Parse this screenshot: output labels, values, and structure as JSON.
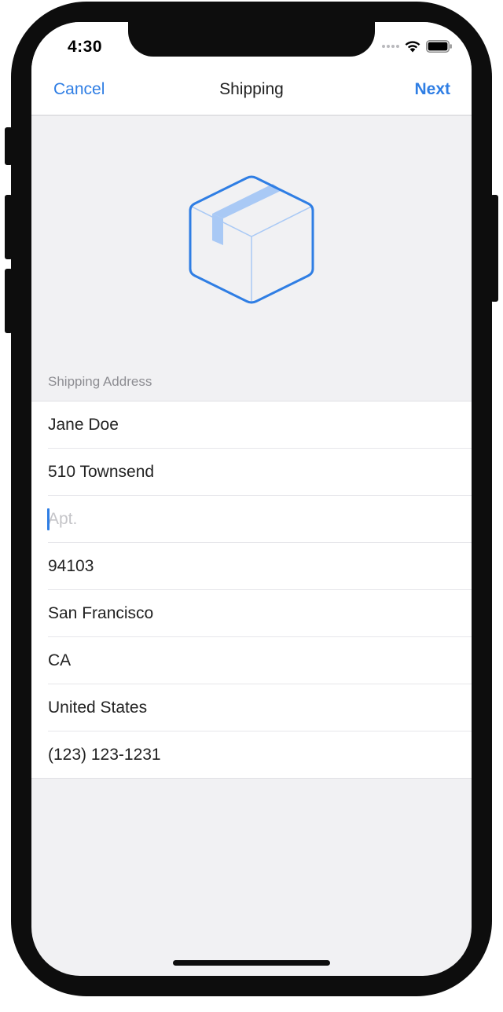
{
  "status_bar": {
    "time": "4:30",
    "icons": [
      "cellular-dots-icon",
      "wifi-icon",
      "battery-icon"
    ]
  },
  "nav": {
    "cancel_label": "Cancel",
    "title": "Shipping",
    "next_label": "Next"
  },
  "illustration": {
    "icon": "package-box-icon",
    "stroke_color": "#2f7ee4",
    "tape_color": "#a9c9f5"
  },
  "section": {
    "header": "Shipping Address"
  },
  "fields": [
    {
      "value": "Jane Doe",
      "placeholder": ""
    },
    {
      "value": "510 Townsend",
      "placeholder": ""
    },
    {
      "value": "",
      "placeholder": "Apt."
    },
    {
      "value": "94103",
      "placeholder": ""
    },
    {
      "value": "San Francisco",
      "placeholder": ""
    },
    {
      "value": "CA",
      "placeholder": ""
    },
    {
      "value": "United States",
      "placeholder": ""
    },
    {
      "value": "(123) 123-1231",
      "placeholder": ""
    }
  ],
  "colors": {
    "accent": "#2f7ee4",
    "background": "#f1f1f3"
  }
}
